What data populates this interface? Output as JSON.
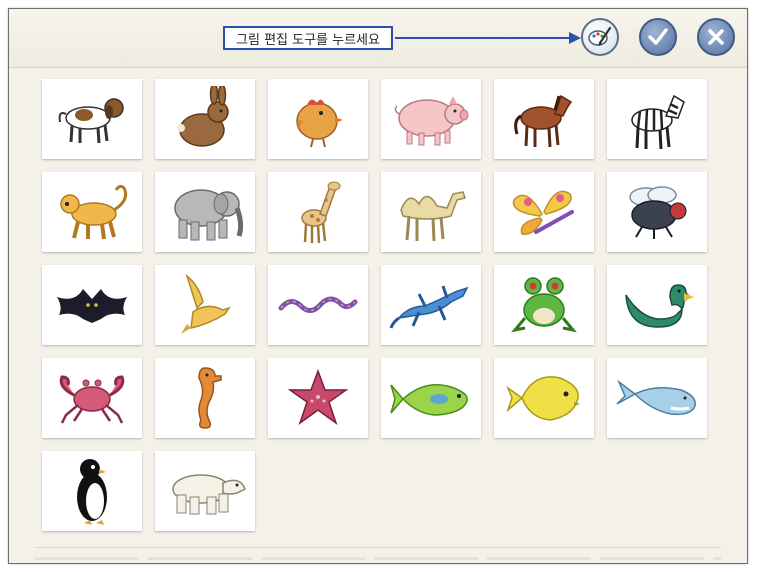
{
  "toolbar": {
    "instruction": "그림 편집 도구를 누르세요",
    "buttons": [
      {
        "name": "paint-tool-button",
        "icon": "paintbrush-icon"
      },
      {
        "name": "confirm-button",
        "icon": "checkmark-icon"
      },
      {
        "name": "close-button",
        "icon": "close-icon"
      }
    ]
  },
  "gallery": {
    "items": [
      {
        "icon": "dog-icon",
        "color": "#8b5a2b"
      },
      {
        "icon": "rabbit-icon",
        "color": "#9a6a3e"
      },
      {
        "icon": "chick-icon",
        "color": "#e8a347"
      },
      {
        "icon": "pig-icon",
        "color": "#f5c5c8"
      },
      {
        "icon": "horse-icon",
        "color": "#a0522d"
      },
      {
        "icon": "zebra-icon",
        "color": "#222222"
      },
      {
        "icon": "monkey-icon",
        "color": "#f0b84a"
      },
      {
        "icon": "elephant-icon",
        "color": "#b8b8b8"
      },
      {
        "icon": "giraffe-icon",
        "color": "#e8c58b"
      },
      {
        "icon": "camel-icon",
        "color": "#e8dba6"
      },
      {
        "icon": "butterfly-icon",
        "color": "#f3c94a"
      },
      {
        "icon": "fly-icon",
        "color": "#3c4150"
      },
      {
        "icon": "bat-icon",
        "color": "#1c1c2a"
      },
      {
        "icon": "bird-icon",
        "color": "#f0c457"
      },
      {
        "icon": "snake-icon",
        "color": "#7f4fb8"
      },
      {
        "icon": "lizard-icon",
        "color": "#4a8fd6"
      },
      {
        "icon": "frog-icon",
        "color": "#5cb843"
      },
      {
        "icon": "duck-icon",
        "color": "#2f8a6a"
      },
      {
        "icon": "crab-icon",
        "color": "#d55a7a"
      },
      {
        "icon": "seahorse-icon",
        "color": "#e2893a"
      },
      {
        "icon": "starfish-icon",
        "color": "#c74a6a"
      },
      {
        "icon": "fish-icon",
        "color": "#9bd44a"
      },
      {
        "icon": "yellow-fish-icon",
        "color": "#f0e046"
      },
      {
        "icon": "whale-icon",
        "color": "#a8cfe8"
      },
      {
        "icon": "penguin-icon",
        "color": "#111111"
      },
      {
        "icon": "polar-bear-icon",
        "color": "#f4f1e6"
      }
    ]
  }
}
